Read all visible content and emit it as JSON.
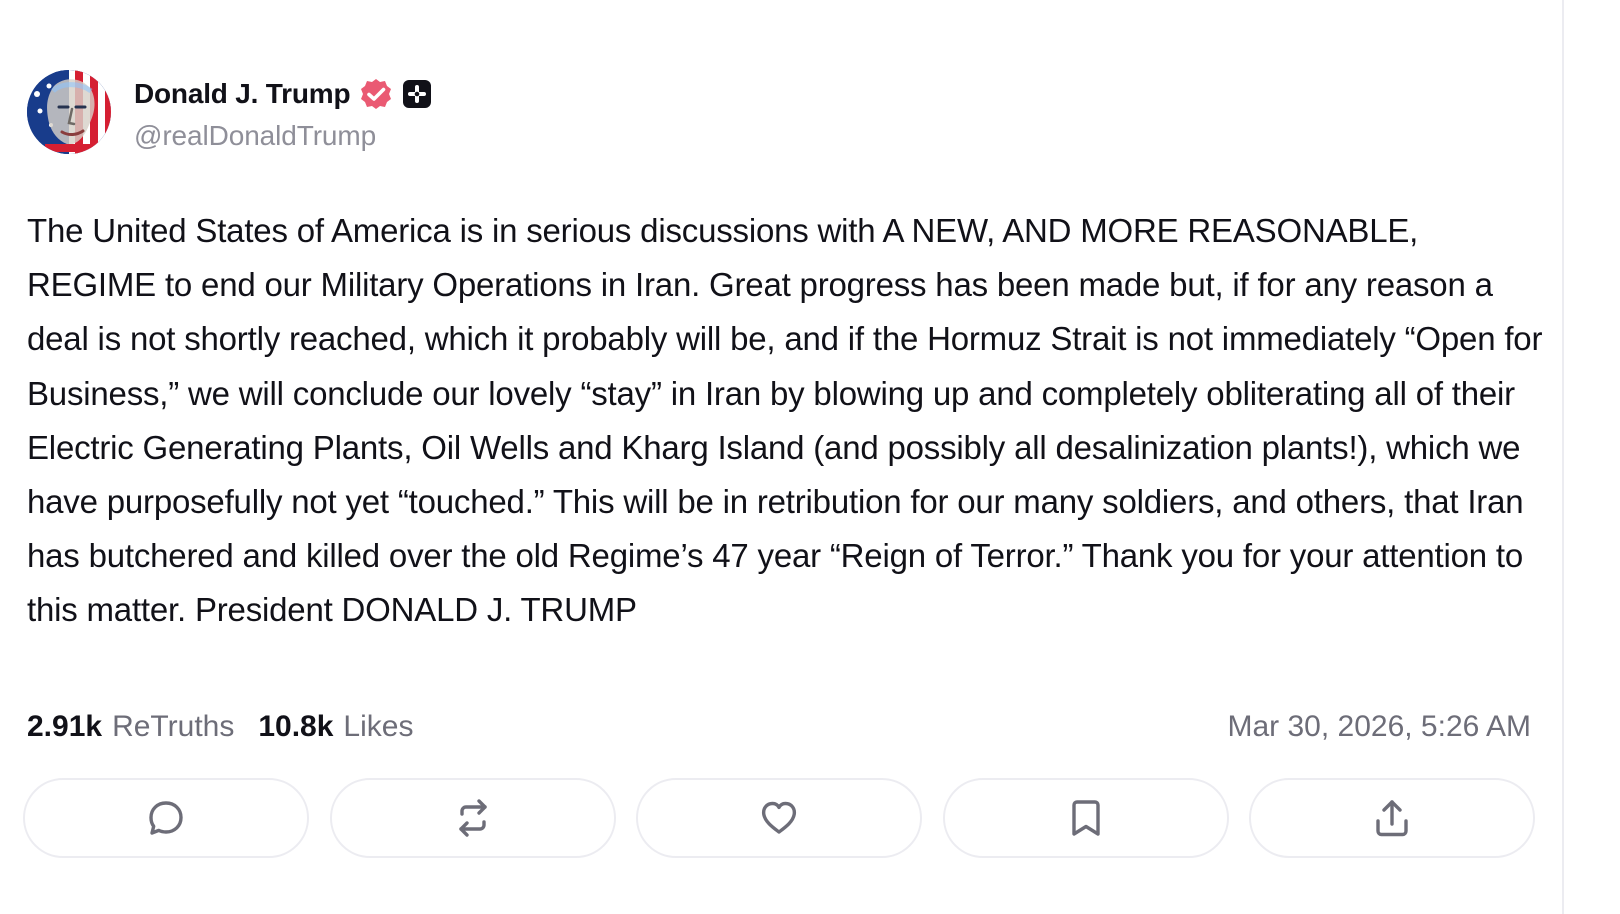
{
  "post": {
    "author": {
      "display_name": "Donald J. Trump",
      "handle": "@realDonaldTrump",
      "verified_badge_icon": "verified-badge-icon",
      "badge_icon": "plus-badge-icon",
      "avatar_icon": "avatar-image"
    },
    "body": "The United States of America is in serious discussions with A NEW, AND MORE REASONABLE, REGIME to end our Military Operations in Iran. Great progress has been made but, if for any reason a deal is not shortly reached, which it probably will be, and if the Hormuz Strait is not immediately “Open for Business,” we will conclude our lovely “stay” in Iran by blowing up and completely obliterating all of their Electric Generating Plants, Oil Wells and Kharg Island (and possibly all desalinization plants!), which we have purposefully not yet “touched.” This will be in retribution for our many soldiers, and others, that Iran has butchered and killed over the old Regime’s 47 year “Reign of Terror.” Thank you for your attention to this matter. President DONALD J. TRUMP",
    "stats": {
      "retruths_count": "2.91k",
      "retruths_label": "ReTruths",
      "likes_count": "10.8k",
      "likes_label": "Likes"
    },
    "timestamp": "Mar 30, 2026, 5:26 AM",
    "actions": [
      {
        "icon": "reply-icon"
      },
      {
        "icon": "retruth-icon"
      },
      {
        "icon": "like-icon"
      },
      {
        "icon": "bookmark-icon"
      },
      {
        "icon": "share-icon"
      }
    ]
  },
  "colors": {
    "verified_badge": "#ea5a73",
    "plus_badge": "#111118",
    "secondary_text": "#6d6d78",
    "handle_text": "#8f8f99",
    "button_border": "#ececf1"
  }
}
